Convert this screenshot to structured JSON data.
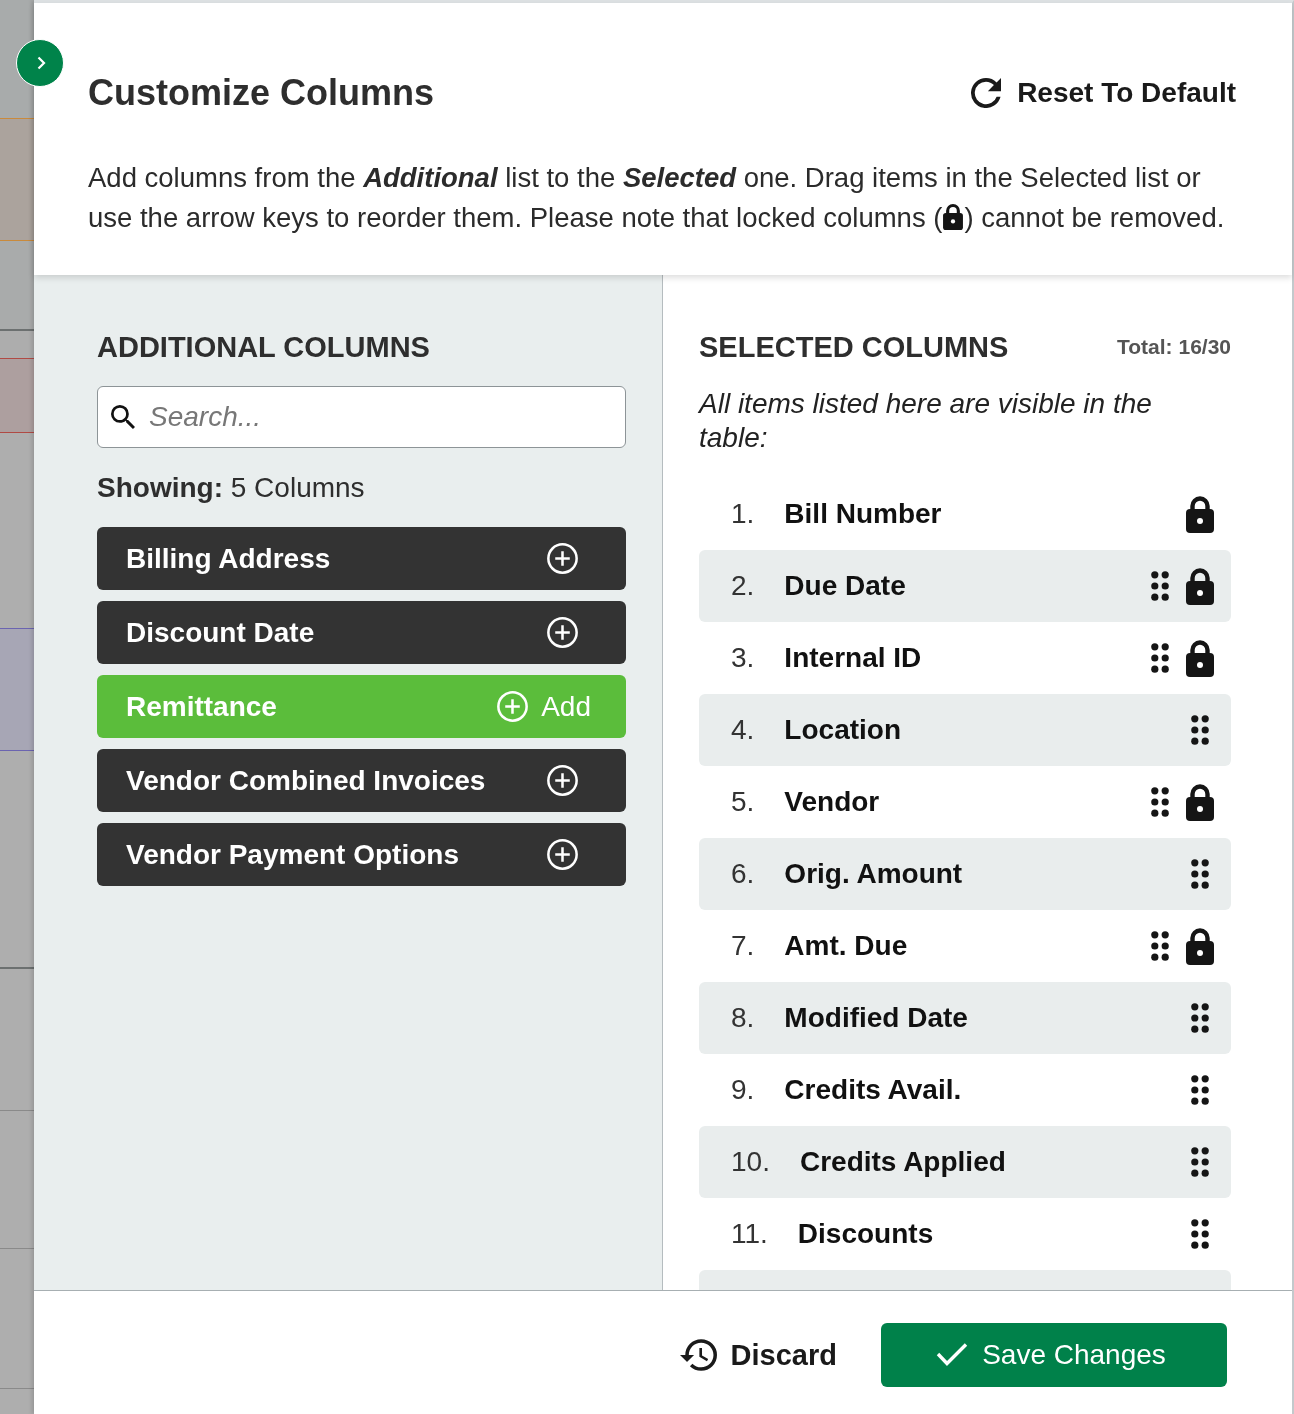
{
  "header": {
    "title": "Customize Columns",
    "reset_button": "Reset To Default",
    "description_before_lock": "Add columns from the **Additional** list to the **Selected** one. Drag items in the Selected list or use the arrow keys to reorder them. Please note that locked columns (",
    "description_after_lock": ") cannot be removed."
  },
  "additional_columns": {
    "heading": "ADDITIONAL COLUMNS",
    "search": {
      "placeholder": "Search..."
    },
    "showing": "**Showing:** 5 Columns",
    "items": [
      {
        "label": "Billing Address",
        "highlighted": false
      },
      {
        "label": "Discount Date",
        "highlighted": false
      },
      {
        "label": "Remittance",
        "highlighted": true,
        "action_label": "Add"
      },
      {
        "label": "Vendor Combined Invoices",
        "highlighted": false
      },
      {
        "label": "Vendor Payment Options",
        "highlighted": false
      }
    ]
  },
  "selected_columns": {
    "heading": "SELECTED COLUMNS",
    "total": "Total: 16/30",
    "note": "All items listed here are visible in the table:",
    "items": [
      {
        "number": "1.",
        "label": "Bill Number",
        "locked": true,
        "draggable": false
      },
      {
        "number": "2.",
        "label": "Due Date",
        "locked": true,
        "draggable": true
      },
      {
        "number": "3.",
        "label": "Internal ID",
        "locked": true,
        "draggable": true
      },
      {
        "number": "4.",
        "label": "Location",
        "locked": false,
        "draggable": true
      },
      {
        "number": "5.",
        "label": "Vendor",
        "locked": true,
        "draggable": true
      },
      {
        "number": "6.",
        "label": "Orig. Amount",
        "locked": false,
        "draggable": true
      },
      {
        "number": "7.",
        "label": "Amt. Due",
        "locked": true,
        "draggable": true
      },
      {
        "number": "8.",
        "label": "Modified Date",
        "locked": false,
        "draggable": true
      },
      {
        "number": "9.",
        "label": "Credits Avail.",
        "locked": false,
        "draggable": true
      },
      {
        "number": "10.",
        "label": "Credits Applied",
        "locked": false,
        "draggable": true
      },
      {
        "number": "11.",
        "label": "Discounts",
        "locked": false,
        "draggable": true
      }
    ],
    "more_below": true
  },
  "footer": {
    "discard_button": "Discard",
    "save_button": "Save Changes"
  }
}
